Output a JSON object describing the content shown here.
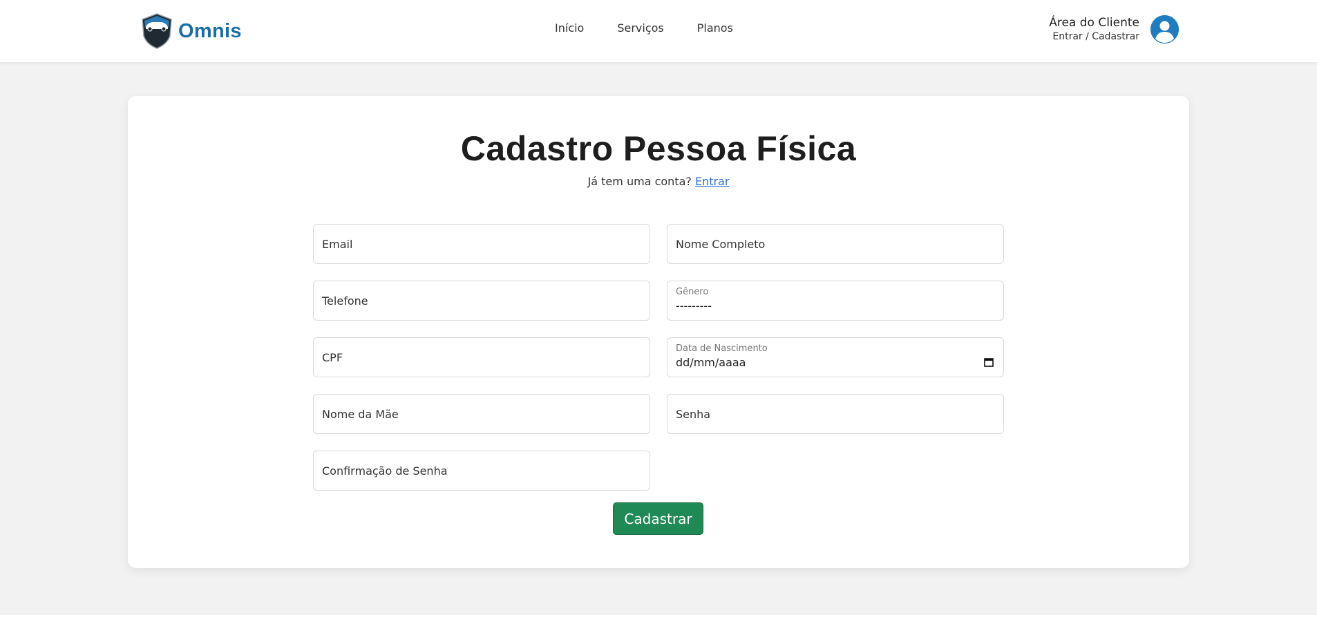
{
  "header": {
    "brand": "Omnis",
    "nav": [
      {
        "label": "Início"
      },
      {
        "label": "Serviços"
      },
      {
        "label": "Planos"
      }
    ],
    "client_area": {
      "title": "Área do Cliente",
      "subtitle": "Entrar / Cadastrar"
    }
  },
  "form": {
    "title": "Cadastro Pessoa Física",
    "have_account_text": "Já tem uma conta?",
    "login_link": "Entrar",
    "fields": {
      "email": {
        "placeholder": "Email",
        "value": ""
      },
      "full_name": {
        "placeholder": "Nome Completo",
        "value": ""
      },
      "phone": {
        "placeholder": "Telefone",
        "value": ""
      },
      "gender": {
        "label": "Gênero",
        "selected": "---------"
      },
      "cpf": {
        "placeholder": "CPF",
        "value": ""
      },
      "birth_date": {
        "label": "Data de Nascimento",
        "value": "dd/mm/aaaa"
      },
      "mother_name": {
        "placeholder": "Nome da Mãe",
        "value": ""
      },
      "password": {
        "placeholder": "Senha",
        "value": ""
      },
      "password_confirm": {
        "placeholder": "Confirmação de Senha",
        "value": ""
      }
    },
    "submit_label": "Cadastrar"
  },
  "colors": {
    "brand": "#1b6fa8",
    "submit": "#1f8a55",
    "link": "#2a6fdb",
    "page_bg": "#f2f2f2"
  }
}
